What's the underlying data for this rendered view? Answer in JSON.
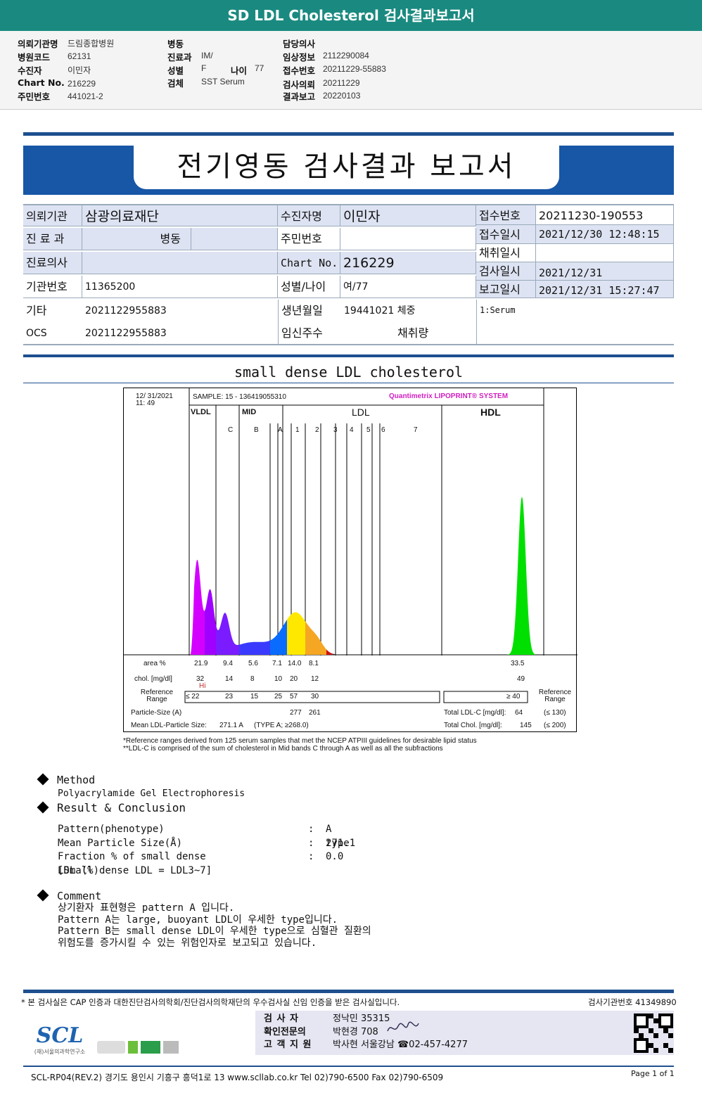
{
  "title": "SD LDL Cholesterol 검사결과보고서",
  "header": {
    "hospital_label": "의뢰기관명",
    "hospital": "드림종합병원",
    "code_label": "병원코드",
    "code": "62131",
    "patient_label": "수진자",
    "patient": "이민자",
    "chart_label": "Chart No.",
    "chart": "216229",
    "id_label": "주민번호",
    "id": "441021-2",
    "ward_label": "병동",
    "ward": "",
    "dept_label": "진료과",
    "dept": "IM/",
    "sex_label": "성별",
    "sex": "F",
    "age_label": "나이",
    "age": "77",
    "specimen_label": "검체",
    "specimen": "SST Serum",
    "doctor_label": "담당의사",
    "doctor": "",
    "clinical_label": "임상정보",
    "clinical": "2112290084",
    "receipt_label": "접수번호",
    "receipt": "20211229-55883",
    "request_label": "검사의뢰",
    "request": "20211229",
    "report_label": "결과보고",
    "report": "20220103"
  },
  "report_title": "전기영동 검사결과 보고서",
  "info": {
    "r1": [
      "의뢰기관",
      "삼광의료재단",
      "수진자명",
      "이민자",
      "접수번호",
      "20211230-190553"
    ],
    "r2": [
      "진 료 과",
      "병동",
      "주민번호",
      "",
      "접수일시",
      "2021/12/30 12:48:15"
    ],
    "r3": [
      "진료의사",
      "",
      "Chart No.",
      "216229",
      "채취일시",
      ""
    ],
    "r4": [
      "기관번호",
      "11365200",
      "성별/나이",
      "여/77",
      "검사일시",
      "2021/12/31"
    ],
    "r5": [
      "보고일시",
      "2021/12/31 15:27:47"
    ],
    "r6": [
      "기타",
      "2021122955883",
      "생년월일",
      "19441021 체중",
      "1:Serum"
    ],
    "r7": [
      "OCS",
      "2021122955883",
      "임신주수",
      "채취량"
    ]
  },
  "section_title": "small dense LDL cholesterol",
  "chart_data": {
    "type": "area",
    "datetime": [
      "12/ 31/2021",
      "11: 49"
    ],
    "sample": "SAMPLE:    15 - 136419055310",
    "brand": "Quantimetrix LIPOPRINT® SYSTEM",
    "groups": [
      "VLDL",
      "MID",
      "LDL",
      "HDL"
    ],
    "bands": [
      "C",
      "B",
      "A",
      "1",
      "2",
      "3",
      "4",
      "5",
      "6",
      "7"
    ],
    "area_label": "area %",
    "area": [
      "21.9",
      "9.4",
      "5.6",
      "7.1",
      "14.0",
      "8.1"
    ],
    "area_hdl": "33.5",
    "chol_label": "chol. [mg/dl]",
    "chol": [
      "32",
      "14",
      "8",
      "10",
      "20",
      "12"
    ],
    "chol_hdl": "49",
    "flag": "Hi",
    "ref_label": "Reference Range",
    "ref": [
      "≤ 22",
      "23",
      "15",
      "25",
      "57",
      "30"
    ],
    "ref_hdl": "≥ 40",
    "size_label": "Particle-Size (A)",
    "sizes": [
      "277",
      "261"
    ],
    "mean_label": "Mean LDL-Particle Size:",
    "mean": "271.1 A",
    "mean_type": "(TYPE A; ≥268.0)",
    "total_ldl_label": "Total LDL-C [mg/dl]:",
    "total_ldl": "64",
    "total_ldl_ref": "(≤ 130)",
    "total_chol_label": "Total Chol. [mg/dl]:",
    "total_chol": "145",
    "total_chol_ref": "(≤ 200)",
    "colors": [
      "#d400ff",
      "#a000ff",
      "#7a1cff",
      "#3a3aff",
      "#0a6cff",
      "#ffe800",
      "#f5a623",
      "#d01010",
      "#00e000"
    ]
  },
  "notes": [
    "*Reference ranges derived from 125 serum samples that met the NCEP ATPIII guidelines for desirable lipid status",
    "**LDL-C is comprised of the sum of cholesterol in Mid bands C through A as well as all the subfractions"
  ],
  "method": {
    "title": "Method",
    "text": "Polyacrylamide Gel Electrophoresis"
  },
  "result": {
    "title": "Result & Conclusion",
    "rows": [
      [
        "Pattern(phenotype)",
        ":",
        "A type"
      ],
      [
        "Mean Particle Size(Å)",
        ":",
        "271.1"
      ],
      [
        "Fraction % of small dense LDL (%)",
        ":",
        "0.0"
      ]
    ],
    "note": "[Small dense LDL = LDL3~7]"
  },
  "comment": {
    "title": "Comment",
    "lines": [
      "상기환자 표현형은 pattern A 입니다.",
      "Pattern A는 large, buoyant LDL이 우세한 type입니다.",
      "Pattern B는 small dense LDL이 우세한 type으로 심혈관 질환의",
      "위험도를 증가시킬 수 있는 위험인자로 보고되고 있습니다."
    ]
  },
  "footer": {
    "cert": "* 본 검사실은 CAP 인증과 대한진단검사의학회/진단검사의학재단의 우수검사실 신임 인증을 받은 검사실입니다.",
    "lab_no": "검사기관번호 41349890",
    "tester": [
      "검   사   자",
      "정낙민 35315"
    ],
    "doctor": [
      "확인전문의",
      "박현경 708"
    ],
    "support": [
      "고 객 지 원",
      "박사현 서울강남 ☎02-457-4277"
    ],
    "logo": "SCL",
    "logo_sub": "(재)서울의과학연구소",
    "address": "SCL-RP04(REV.2)  경기도 용인시 기흥구 흥덕1로 13  www.scllab.co.kr   Tel 02)790-6500   Fax 02)790-6509",
    "page": "Page 1 of 1"
  }
}
